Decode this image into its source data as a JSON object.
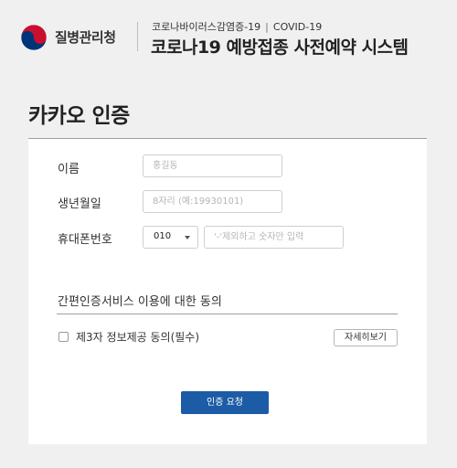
{
  "header": {
    "agency_name": "질병관리청",
    "subtitle_left": "코로나바이러스감염증-19",
    "subtitle_sep": "|",
    "subtitle_right": "COVID-19",
    "system_title": "코로나19 예방접종 사전예약 시스템"
  },
  "page": {
    "title": "카카오 인증"
  },
  "form": {
    "name": {
      "label": "이름",
      "placeholder": "홍길동",
      "value": ""
    },
    "birth": {
      "label": "생년월일",
      "placeholder": "8자리 (예:19930101)",
      "value": ""
    },
    "phone": {
      "label": "휴대폰번호",
      "prefix_selected": "010",
      "placeholder": "'-'제외하고 숫자만 입력",
      "value": ""
    }
  },
  "consent": {
    "title": "간편인증서비스 이용에 대한 동의",
    "checkbox_label": "제3자 정보제공 동의(필수)",
    "checked": false,
    "details_button": "자세히보기"
  },
  "actions": {
    "submit_label": "인증 요청"
  },
  "colors": {
    "primary": "#1c5ba5",
    "background": "#f0f0f0",
    "logo_red": "#c8102e",
    "logo_blue": "#003478"
  },
  "icons": {
    "logo": "taegeuk-logo-icon",
    "select": "chevron-down-icon",
    "checkbox": "checkbox-icon"
  }
}
